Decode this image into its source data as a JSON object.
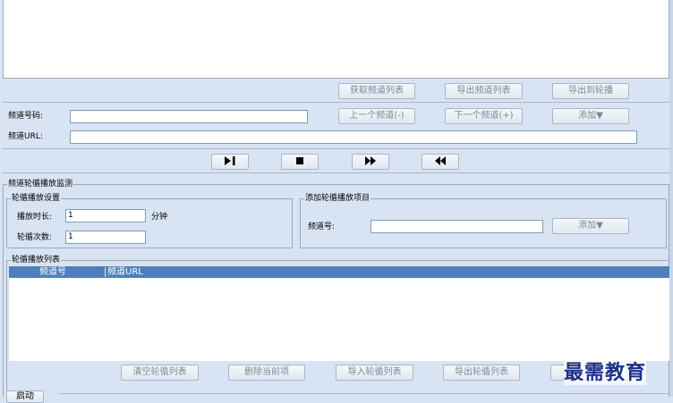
{
  "channel_list_buttons": {
    "get_list": "获取频道列表",
    "export_list": "导出频道列表",
    "export_to_carousel": "导出到轮播"
  },
  "channel_form": {
    "number_label": "频道号码:",
    "number_value": "",
    "url_label": "频道URL:",
    "url_value": "",
    "prev_button": "上一个频道(-)",
    "next_button": "下一个频道(+)",
    "add_button": "添加▼"
  },
  "media_controls": {
    "icons": [
      "play-pause-icon",
      "stop-icon",
      "fast-forward-icon",
      "rewind-icon"
    ]
  },
  "monitor": {
    "title": "频道轮循播放监测",
    "settings": {
      "title": "轮循播放设置",
      "duration_label": "播放时长:",
      "duration_value": "1",
      "duration_unit": "分钟",
      "count_label": "轮循次数:",
      "count_value": "1"
    },
    "add_item": {
      "title": "添加轮循播放项目",
      "channel_label": "频道号:",
      "channel_value": "",
      "add_button": "添加▼"
    },
    "playlist": {
      "title": "轮循播放列表",
      "columns": [
        "频道号",
        "频道URL"
      ],
      "rows": [],
      "buttons": {
        "clear": "清空轮循列表",
        "delete": "删除当前项",
        "import": "导入轮循列表",
        "export": "导出轮循列表"
      }
    }
  },
  "bottom": {
    "button": "启动"
  },
  "watermark": "最需教育",
  "colors": {
    "panel_bg": "#d8e4f3",
    "header_blue": "#4e7fbb",
    "input_border": "#7f9db9"
  }
}
